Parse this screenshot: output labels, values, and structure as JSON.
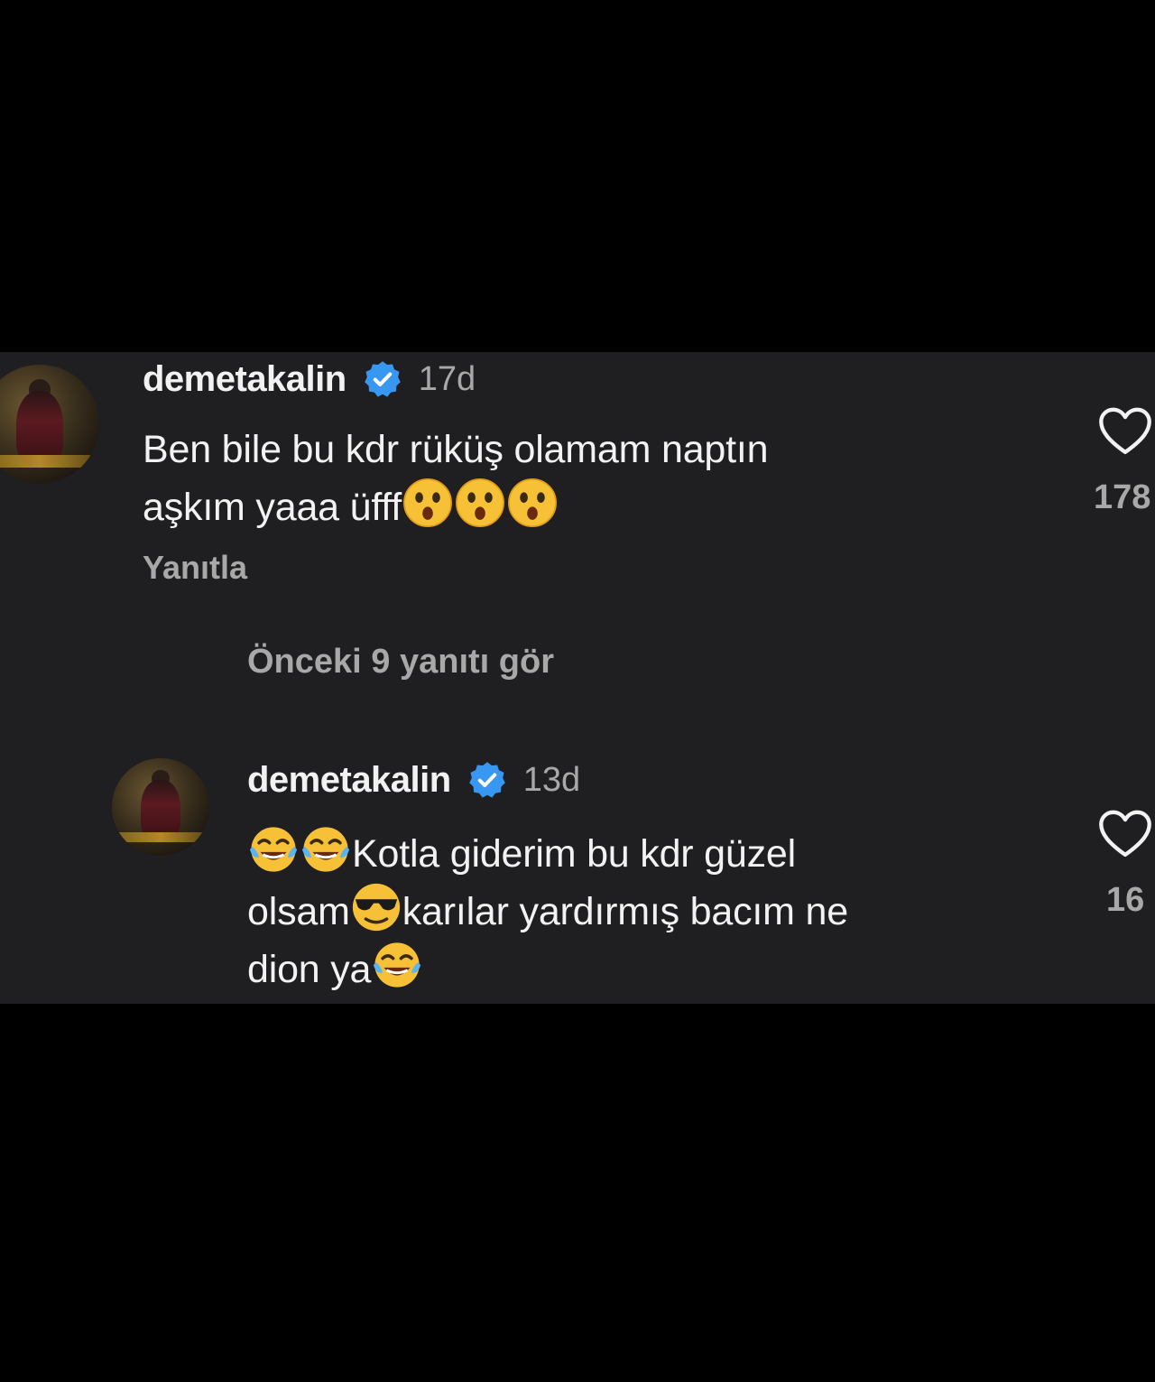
{
  "comments": [
    {
      "username": "demetakalin",
      "time": "17d",
      "line1": "Ben bile bu kdr rüküş olamam naptın",
      "line2_text": "aşkım yaaa üfff",
      "line2_emojis": [
        "astonished-emoji",
        "astonished-emoji",
        "astonished-emoji"
      ],
      "reply_label": "Yanıtla",
      "likes": "178"
    },
    {
      "username": "demetakalin",
      "time": "13d",
      "line1_emojis": [
        "tears-of-joy-emoji",
        "tears-of-joy-emoji"
      ],
      "line1_text": "Kotla giderim bu kdr güzel",
      "line2_text_a": "olsam",
      "line2_emoji": "sunglasses-emoji",
      "line2_text_b": "karılar yardırmış bacım ne",
      "line3_text": "dion ya",
      "line3_emoji": "tears-of-joy-emoji",
      "likes": "16"
    }
  ],
  "view_replies_label": "Önceki 9 yanıtı gör",
  "colors": {
    "background": "#000000",
    "panel": "#1f1f21",
    "primary_text": "#f2f2f2",
    "secondary_text": "#a8a8a8",
    "verified_blue": "#3897f0"
  }
}
